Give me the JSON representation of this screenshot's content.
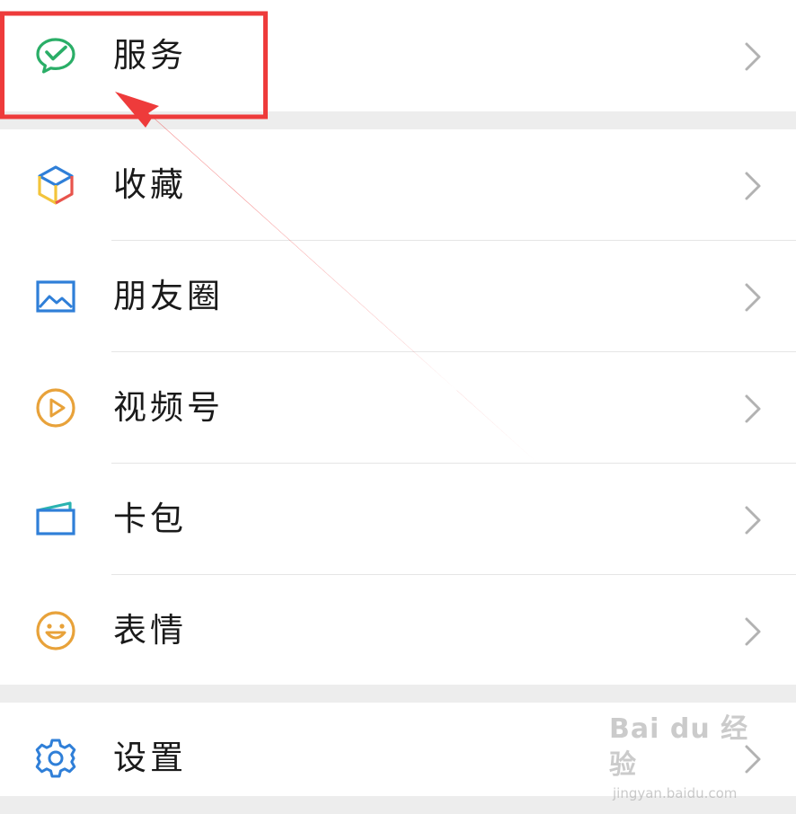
{
  "menu": {
    "items": [
      {
        "key": "services",
        "label": "服务",
        "icon": "wechat-pay-icon"
      },
      {
        "key": "favorites",
        "label": "收藏",
        "icon": "cube-icon"
      },
      {
        "key": "moments",
        "label": "朋友圈",
        "icon": "picture-icon"
      },
      {
        "key": "channels",
        "label": "视频号",
        "icon": "play-icon"
      },
      {
        "key": "cards",
        "label": "卡包",
        "icon": "wallet-icon"
      },
      {
        "key": "stickers",
        "label": "表情",
        "icon": "smile-icon"
      },
      {
        "key": "settings",
        "label": "设置",
        "icon": "gear-icon"
      }
    ]
  },
  "annotation": {
    "highlight_color": "#ee3b3b",
    "target": "services"
  },
  "watermark": {
    "main": "Bai du 经验",
    "sub": "jingyan.baidu.com"
  },
  "colors": {
    "background": "#ededed",
    "row": "#ffffff",
    "text": "#1a1a1a",
    "chevron": "#b2b2b2",
    "green": "#2aae67",
    "blue": "#2f7fd8",
    "orange": "#e8a23a"
  }
}
